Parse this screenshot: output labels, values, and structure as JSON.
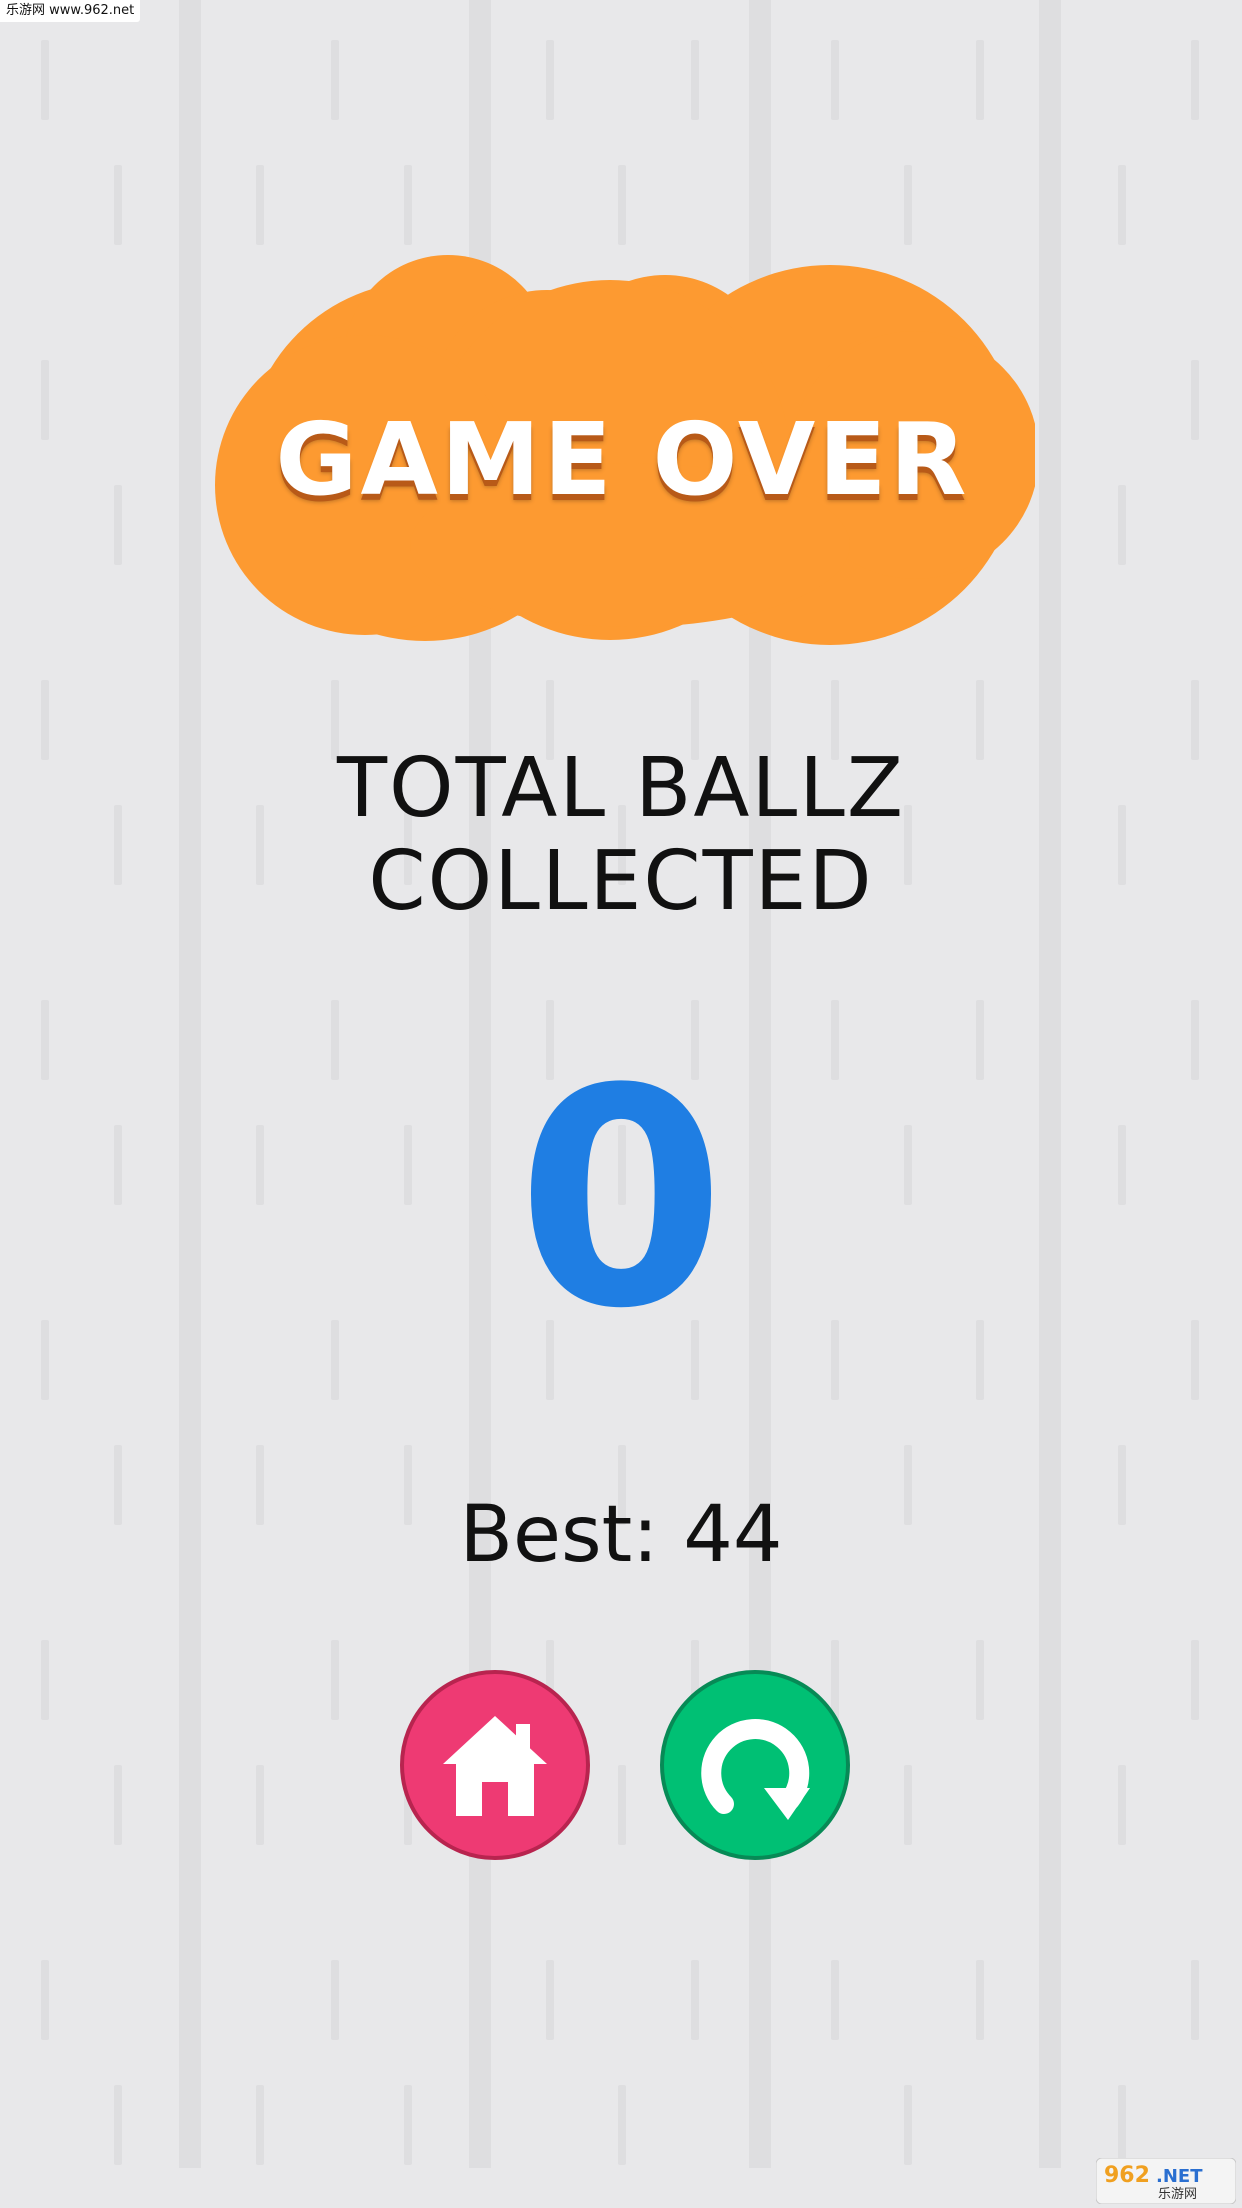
{
  "watermark_top": "乐游网 www.962.net",
  "title": "GAME OVER",
  "subtitle_line1": "TOTAL BALLZ",
  "subtitle_line2": "COLLECTED",
  "score": "0",
  "best_label": "Best:",
  "best_value": "44",
  "buttons": {
    "home_icon": "home-icon",
    "restart_icon": "restart-icon"
  },
  "logo": {
    "number": "962",
    "suffix": ".NET",
    "text": "乐游网"
  },
  "colors": {
    "background": "#e8e8ea",
    "stripe": "#dedee0",
    "cloud": "#fd9a31",
    "score": "#1f7ee3",
    "home_button": "#ee3a73",
    "restart_button": "#00c074"
  }
}
